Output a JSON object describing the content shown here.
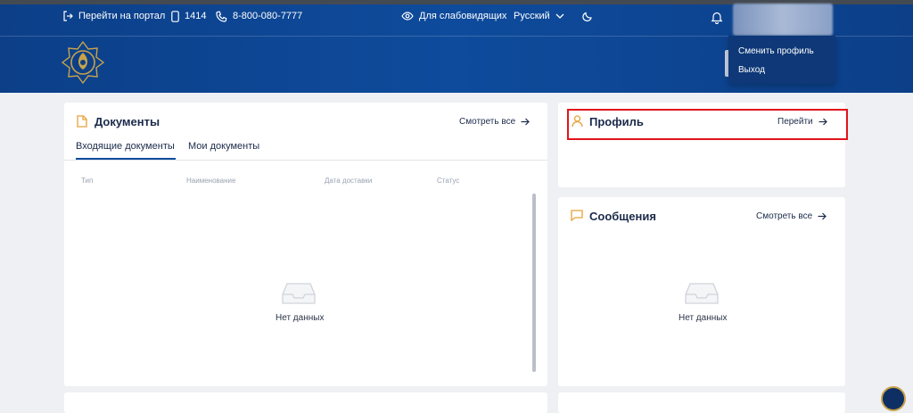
{
  "header": {
    "portal_link": "Перейти на портал",
    "short_phone": "1414",
    "phone": "8-800-080-7777",
    "accessibility": "Для слабовидящих",
    "language": "Русский",
    "icons": [
      "logout-icon",
      "mobile-icon",
      "phone-icon",
      "eye-icon",
      "chevron-down-icon",
      "moon-icon",
      "bell-icon"
    ]
  },
  "user_menu": {
    "items": [
      "Сменить профиль",
      "Выход"
    ]
  },
  "documents": {
    "title": "Документы",
    "see_all": "Смотреть все",
    "tabs": [
      "Входящие документы",
      "Мои документы"
    ],
    "columns": [
      "Тип",
      "Наименование",
      "Дата доставки",
      "Статус"
    ],
    "empty": "Нет данных"
  },
  "profile": {
    "title": "Профиль",
    "go": "Перейти"
  },
  "messages": {
    "title": "Сообщения",
    "see_all": "Смотреть все",
    "empty": "Нет данных"
  },
  "colors": {
    "header_bg": "#0e4b9c",
    "accent_gold": "#e8a23a",
    "highlight_red": "#e3141b"
  }
}
